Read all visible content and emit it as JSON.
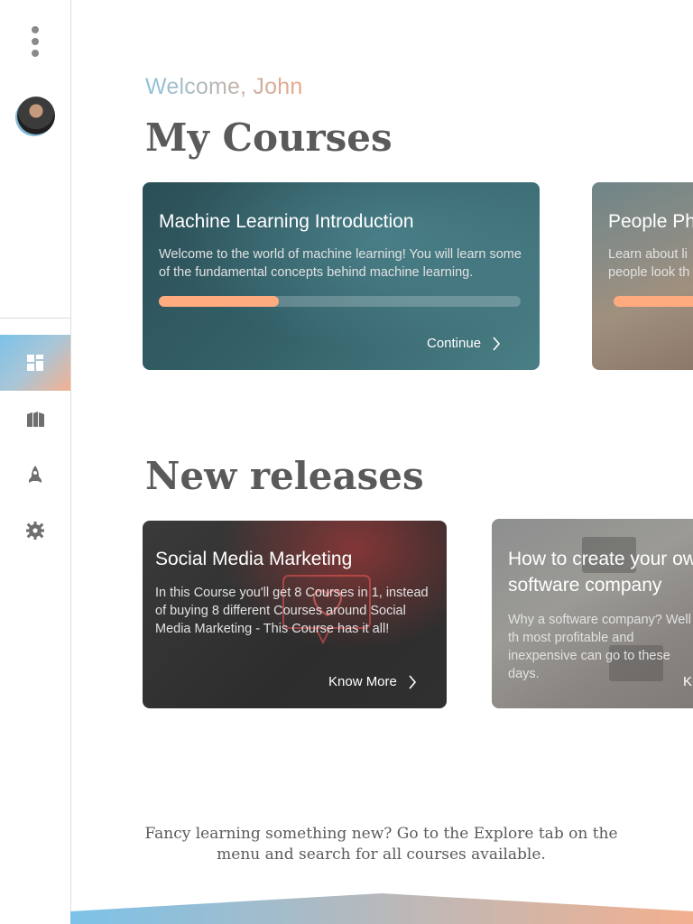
{
  "sidebar": {
    "menu_icon": "kebab-menu-icon",
    "avatar_label": "user-avatar",
    "nav": [
      {
        "name": "dashboard",
        "icon": "dashboard-icon",
        "active": true
      },
      {
        "name": "library",
        "icon": "books-icon",
        "active": false
      },
      {
        "name": "explore",
        "icon": "rocket-icon",
        "active": false
      },
      {
        "name": "settings",
        "icon": "gear-icon",
        "active": false
      }
    ]
  },
  "main": {
    "welcome": "Welcome, John",
    "my_courses_title": "My Courses",
    "new_releases_title": "New releases",
    "footer_text": "Fancy learning something new? Go to the Explore tab on the menu and search for all courses available."
  },
  "my_courses": [
    {
      "title": "Machine Learning Introduction",
      "description": "Welcome to the world of machine learning! You will learn some of the fundamental concepts behind machine learning.",
      "progress": 0.33,
      "action": "Continue"
    },
    {
      "title": "People Ph",
      "description": "Learn about li people look th",
      "progress": 0.5,
      "action": ""
    }
  ],
  "new_releases": [
    {
      "title": "Social Media Marketing",
      "description": "In this Course you'll get 8 Courses in 1, instead of buying 8 different Courses around Social Media Marketing - This Course has it all!",
      "action": "Know More"
    },
    {
      "title_line1": "How to create your ow",
      "title_line2": "software company",
      "description": "Why a software company? Well th most profitable and inexpensive can go to these days.",
      "action": "K"
    }
  ],
  "colors": {
    "accent_orange": "#ffab80",
    "accent_blue": "#7cc2e8",
    "title_gray": "#5a5a5a"
  }
}
